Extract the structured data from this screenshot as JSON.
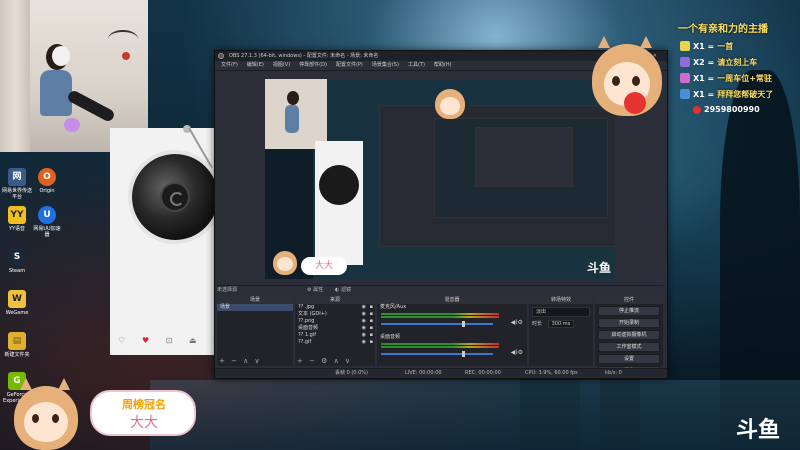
{
  "obs": {
    "title": "OBS 27.1.3 (64-bit, windows) - 配置文件: 未命名 - 场景: 未命名",
    "menu": [
      "文件(F)",
      "编辑(E)",
      "视图(V)",
      "停靠部件(D)",
      "配置文件(P)",
      "场景集合(S)",
      "工具(T)",
      "帮助(H)"
    ],
    "scene_line": {
      "label": "未选择源",
      "props": "⚙ 属性",
      "filters": "◐ 滤镜"
    },
    "panels": {
      "scenes": {
        "title": "场景",
        "items": [
          "场景"
        ]
      },
      "sources": {
        "title": "来源",
        "items": [
          "?? .jpg",
          "文本 (GDI+)",
          "??.png",
          "桌面音频",
          "?? 1.gif",
          "??.gif"
        ]
      },
      "mixer": {
        "title": "混音器",
        "channels": [
          {
            "name": "麦克风/Aux",
            "level": 0.72
          },
          {
            "name": "桌面音频",
            "level": 0.72
          }
        ]
      },
      "transitions": {
        "title": "转场特效",
        "type": "淡出",
        "duration_label": "时长",
        "duration_value": "300 ms"
      },
      "controls": {
        "title": "控件",
        "buttons": [
          "停止推流",
          "开始录制",
          "启动虚拟摄像机",
          "工作室模式",
          "设置",
          "退出"
        ]
      }
    },
    "status": {
      "dropped": "丢帧 0 (0.0%)",
      "live": "LIVE: 00:00:00",
      "rec": "REC: 00:00:00",
      "cpu": "CPU: 3.9%, 60.00 fps",
      "kbps": "kb/s: 0"
    }
  },
  "overlay": {
    "title": "一个有亲和力的主播",
    "rows": [
      {
        "count": "X1 =",
        "text": "一首",
        "color": "#e8d34a"
      },
      {
        "count": "X2 =",
        "text": "请立刻上车",
        "color": "#8e6cd6"
      },
      {
        "count": "X1 =",
        "text": "一周车位+常驻",
        "color": "#d06ad0"
      },
      {
        "count": "X1 =",
        "text": "拜拜您帮破天了",
        "color": "#4a8fd6"
      }
    ],
    "phone": "2959800990"
  },
  "badge": {
    "title": "周榜冠名",
    "name": "大大"
  },
  "mini_badge": {
    "name": "大大"
  },
  "brand": "斗鱼",
  "widget": {
    "controls": [
      "♡",
      "♥",
      "⊡",
      "⏏",
      "⊘"
    ]
  },
  "desktop_icons": [
    {
      "label": "网易世界传送平台",
      "color": "#3a5a8a",
      "glyph": "网"
    },
    {
      "label": "Origin",
      "color": "#e06020",
      "glyph": "O"
    },
    {
      "label": "YY语音",
      "color": "#f0c020",
      "glyph": "YY"
    },
    {
      "label": "网易UU加速器",
      "color": "#2070e0",
      "glyph": "U"
    },
    {
      "label": "Steam",
      "color": "#1b2838",
      "glyph": "S"
    },
    {
      "label": "WeGame",
      "color": "#f0c040",
      "glyph": "W"
    },
    {
      "label": "新建文件夹",
      "color": "#e0b030",
      "glyph": "▤"
    },
    {
      "label": "GeForce Experience",
      "color": "#76b900",
      "glyph": "G"
    }
  ],
  "colors": {
    "obs_bg": "#2b2e38",
    "accent_yellow": "#ffe066",
    "badge_pink": "#e06c9c"
  }
}
